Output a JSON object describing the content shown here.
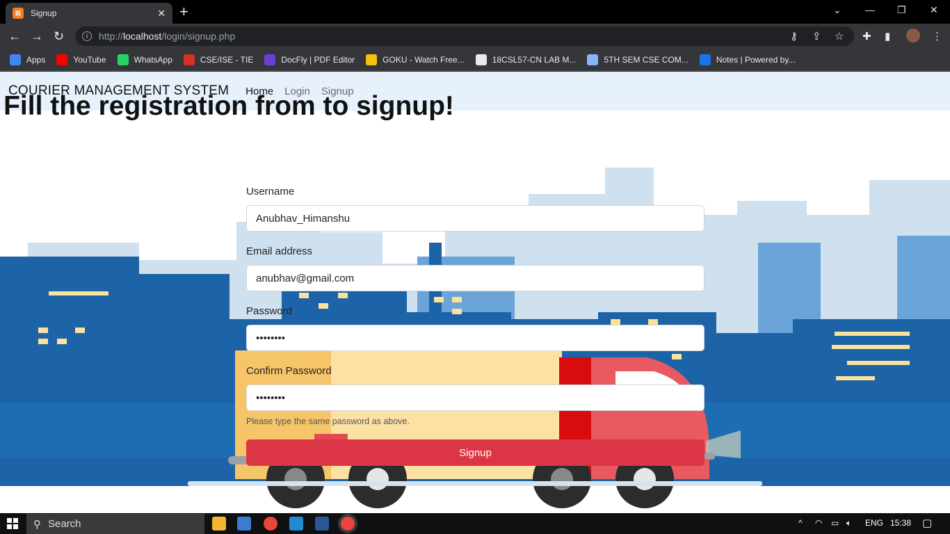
{
  "browser": {
    "tab_title": "Signup",
    "tab_favicon": "xampp-icon",
    "url_host": "localhost",
    "url_prefix": "http://",
    "url_path": "/login/signup.php"
  },
  "bookmarks": [
    {
      "label": "Apps",
      "icon": "apps-grid-icon",
      "color": "#4285f4"
    },
    {
      "label": "YouTube",
      "icon": "youtube-icon",
      "color": "#ff0000"
    },
    {
      "label": "WhatsApp",
      "icon": "whatsapp-icon",
      "color": "#25d366"
    },
    {
      "label": "CSE/ISE - TIE",
      "icon": "bookmark-icon",
      "color": "#d93025"
    },
    {
      "label": "DocFly | PDF Editor",
      "icon": "docfly-icon",
      "color": "#6a3fd6"
    },
    {
      "label": "GOKU - Watch Free...",
      "icon": "goku-icon",
      "color": "#f4c20d"
    },
    {
      "label": "18CSL57-CN LAB M...",
      "icon": "globe-icon",
      "color": "#e8eaed"
    },
    {
      "label": "5TH SEM CSE COM...",
      "icon": "moon-icon",
      "color": "#8ab4f8"
    },
    {
      "label": "Notes | Powered by...",
      "icon": "box-icon",
      "color": "#1a73e8"
    }
  ],
  "navbar": {
    "brand": "COURIER MANAGEMENT SYSTEM",
    "links": [
      "Home",
      "Login",
      "Signup"
    ]
  },
  "form": {
    "heading": "Fill the registration from to signup!",
    "username_label": "Username",
    "username_value": "Anubhav_Himanshu",
    "email_label": "Email address",
    "email_value": "anubhav@gmail.com",
    "password_label": "Password",
    "password_value": "••••••••",
    "confirm_label": "Confirm Password",
    "confirm_value": "••••••••",
    "help_text": "Please type the same password as above.",
    "submit_label": "Signup",
    "submit_color": "#dc3545"
  },
  "taskbar": {
    "search_placeholder": "Search",
    "language": "ENG",
    "time": "15:38"
  }
}
